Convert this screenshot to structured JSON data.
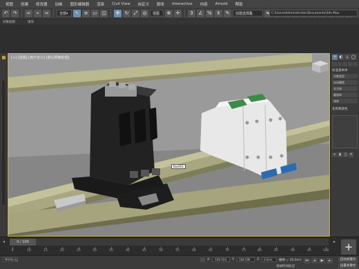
{
  "menu": [
    "视图",
    "创建",
    "修改器",
    "动画",
    "图形编辑器",
    "渲染",
    "Civil View",
    "自定义",
    "脚本",
    "Interactive",
    "内容",
    "Arnold",
    "帮助"
  ],
  "toolbar": {
    "view_dropdown": "视图",
    "selection_set": "创建选择集",
    "path": "C:\\Users\\Administrator\\Documents\\3ds Max"
  },
  "ribbon": [
    "对象绘制",
    "填充"
  ],
  "viewport": {
    "label": "[+] [透视] [用户定义] [默认明暗处理]",
    "tooltip": "Box001"
  },
  "command_panel": {
    "title": "标准基本体",
    "items": [
      "对象类型",
      "自动栅格",
      "长方体",
      "圆锥体",
      "球体"
    ],
    "section": "名称和颜色"
  },
  "timeline": {
    "frame_label": "0 / 100",
    "ticks": [
      "0",
      "10",
      "15",
      "20",
      "25",
      "30",
      "35",
      "40",
      "45",
      "50",
      "55",
      "60",
      "65",
      "70",
      "75",
      "80",
      "85",
      "90",
      "95",
      "100"
    ]
  },
  "status": {
    "script_label": "MAXScript",
    "x_label": "X:",
    "x_value": "-160.934",
    "y_label": "Y:",
    "y_value": "168.586",
    "z_label": "Z:",
    "z_value": "0.0cm",
    "grid_label": "栅格 = 10.0cm",
    "time_label": "添加时间标记",
    "autokey": "自动关键点",
    "setkey": "设置关键点"
  },
  "colors": {
    "viewport_bg": "#8e8e8e",
    "accent_green": "#3d8a4a",
    "accent_blue": "#2b6cb0"
  }
}
